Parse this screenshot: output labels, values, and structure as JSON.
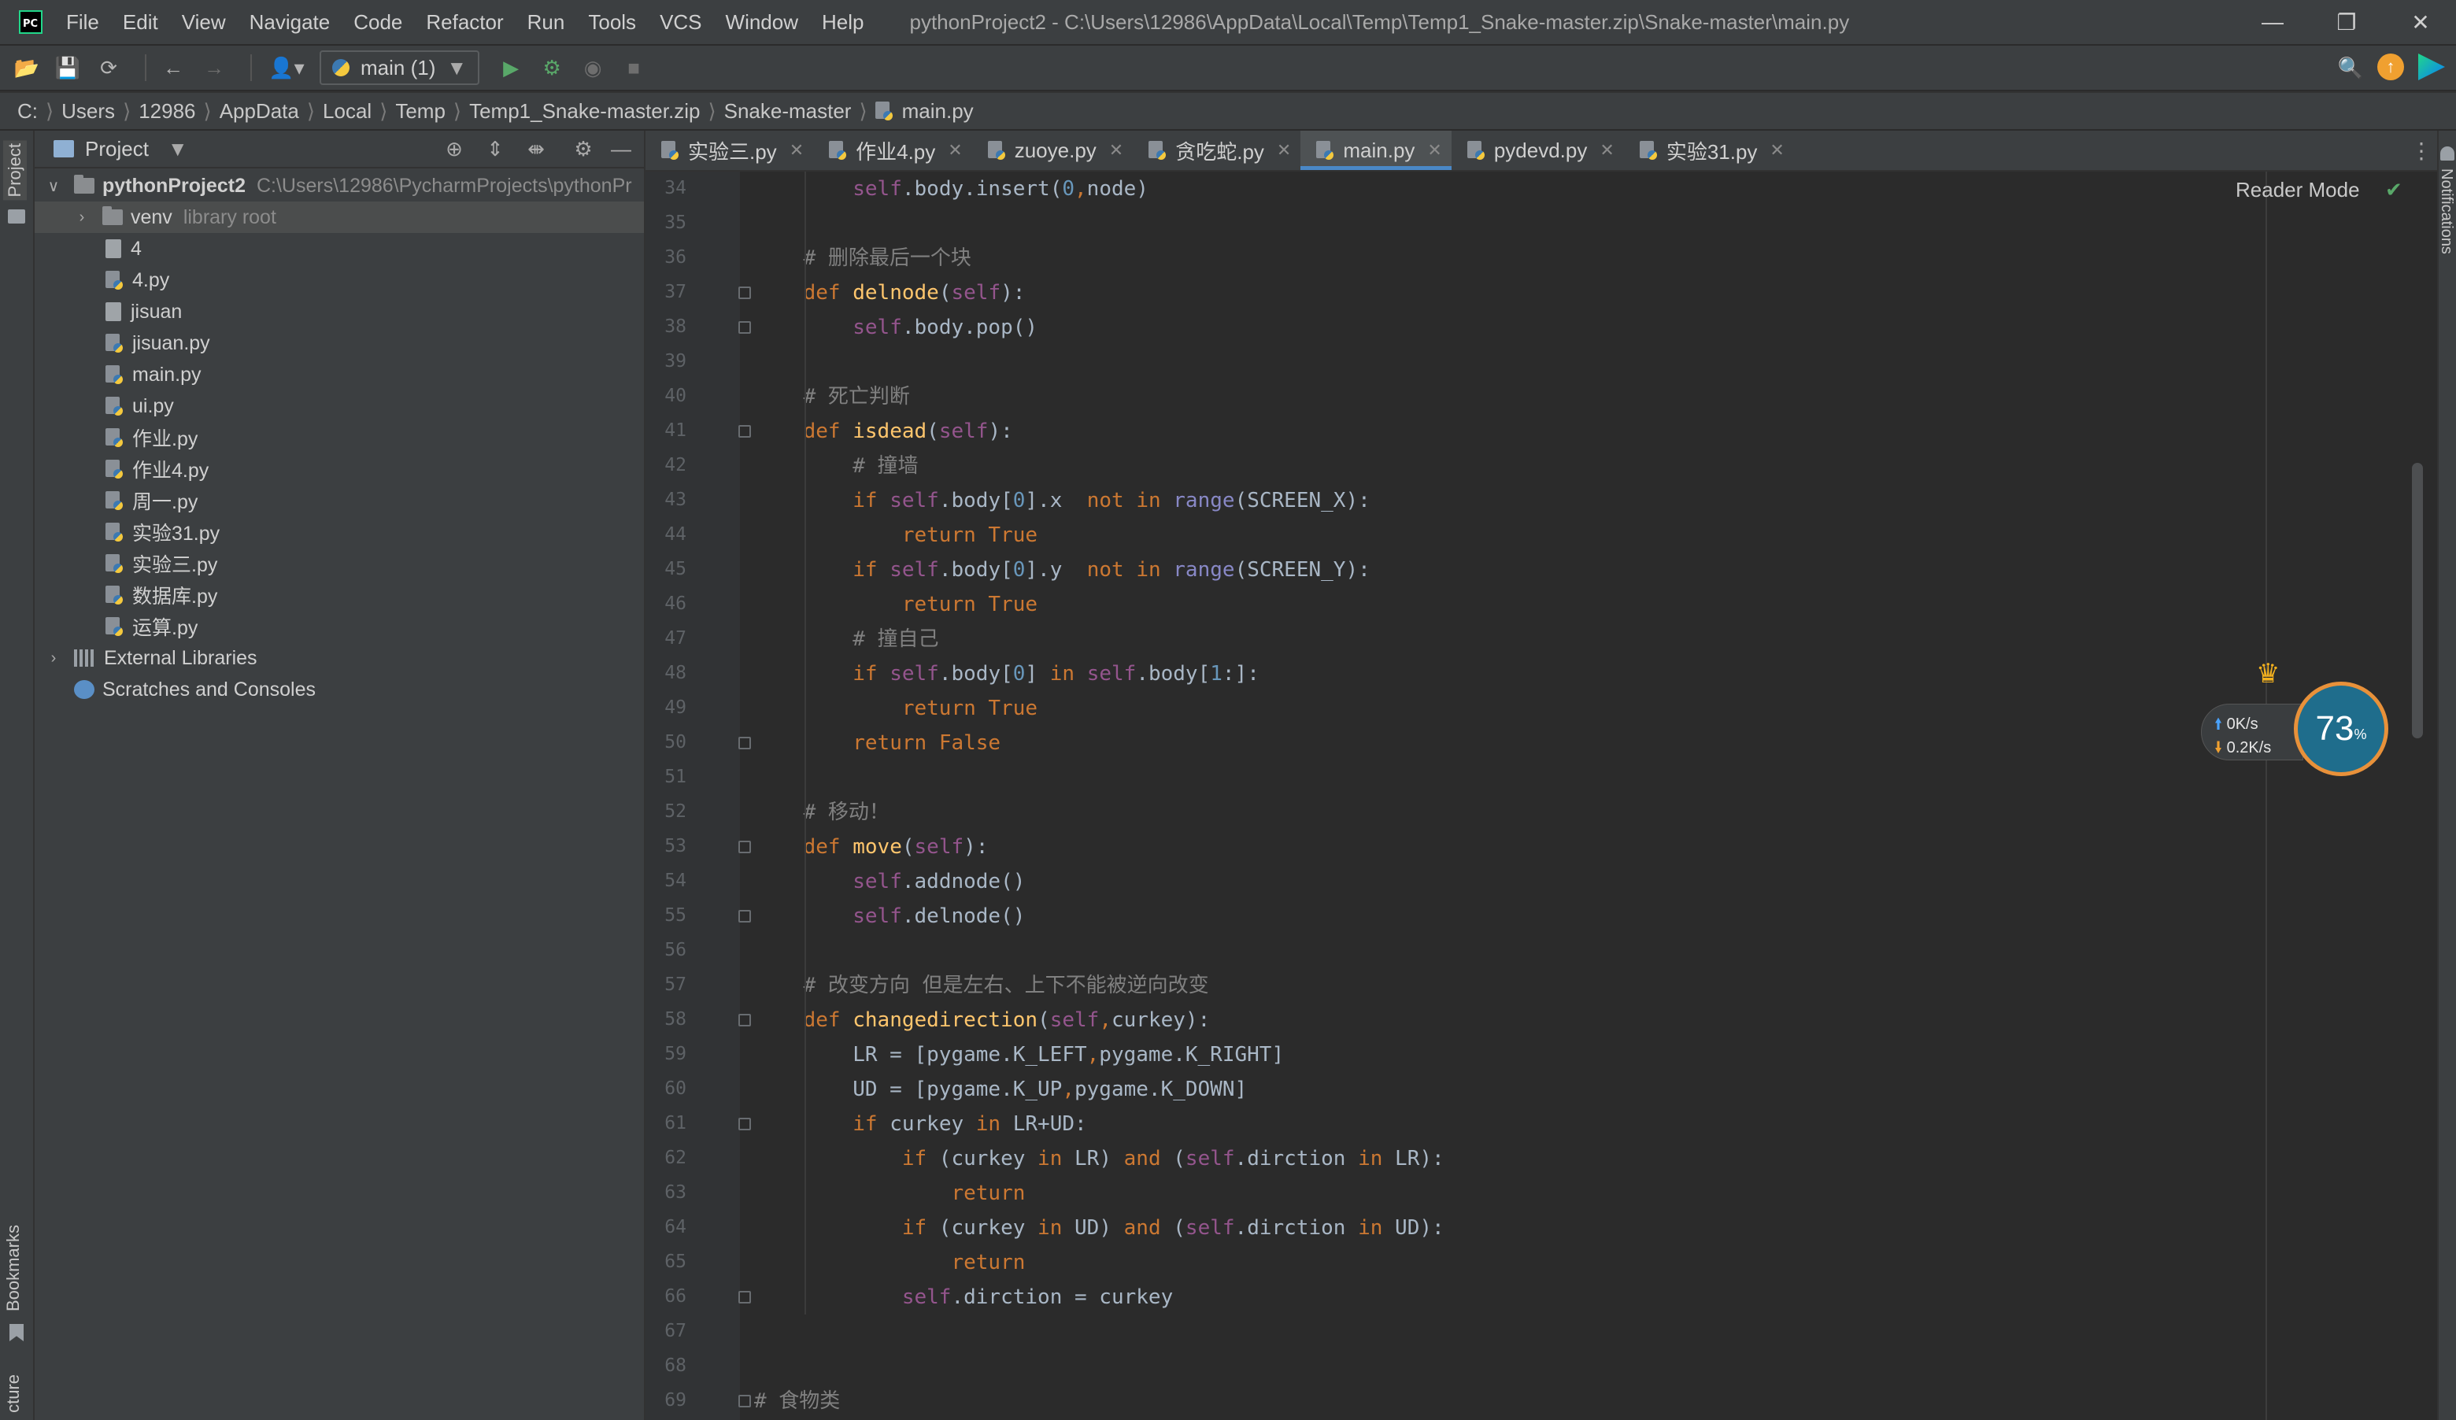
{
  "menu": {
    "items": [
      "File",
      "Edit",
      "View",
      "Navigate",
      "Code",
      "Refactor",
      "Run",
      "Tools",
      "VCS",
      "Window",
      "Help"
    ],
    "window_title": "pythonProject2 - C:\\Users\\12986\\AppData\\Local\\Temp\\Temp1_Snake-master.zip\\Snake-master\\main.py"
  },
  "toolbar": {
    "run_config": "main (1)"
  },
  "breadcrumb": [
    "C:",
    "Users",
    "12986",
    "AppData",
    "Local",
    "Temp",
    "Temp1_Snake-master.zip",
    "Snake-master",
    "main.py"
  ],
  "left_stripe": {
    "project": "Project",
    "bookmarks": "Bookmarks",
    "structure": "cture"
  },
  "right_stripe": {
    "notifications": "Notifications"
  },
  "project_panel": {
    "title": "Project",
    "root": {
      "name": "pythonProject2",
      "path": "C:\\Users\\12986\\PycharmProjects\\pythonPr"
    },
    "venv": {
      "name": "venv",
      "note": "library root"
    },
    "files": [
      {
        "name": "4",
        "type": "text"
      },
      {
        "name": "4.py",
        "type": "py"
      },
      {
        "name": "jisuan",
        "type": "text"
      },
      {
        "name": "jisuan.py",
        "type": "py"
      },
      {
        "name": "main.py",
        "type": "py"
      },
      {
        "name": "ui.py",
        "type": "py"
      },
      {
        "name": "作业.py",
        "type": "py"
      },
      {
        "name": "作业4.py",
        "type": "py"
      },
      {
        "name": "周一.py",
        "type": "py"
      },
      {
        "name": "实验31.py",
        "type": "py"
      },
      {
        "name": "实验三.py",
        "type": "py"
      },
      {
        "name": "数据库.py",
        "type": "py"
      },
      {
        "name": "运算.py",
        "type": "py"
      }
    ],
    "external_libraries": "External Libraries",
    "scratches": "Scratches and Consoles"
  },
  "tabs": [
    {
      "label": "实验三.py",
      "active": false
    },
    {
      "label": "作业4.py",
      "active": false
    },
    {
      "label": "zuoye.py",
      "active": false
    },
    {
      "label": "贪吃蛇.py",
      "active": false
    },
    {
      "label": "main.py",
      "active": true
    },
    {
      "label": "pydevd.py",
      "active": false
    },
    {
      "label": "实验31.py",
      "active": false
    }
  ],
  "editor": {
    "reader_mode": "Reader Mode",
    "line_numbers": [
      "34",
      "35",
      "36",
      "37",
      "38",
      "39",
      "40",
      "41",
      "42",
      "43",
      "44",
      "45",
      "46",
      "47",
      "48",
      "49",
      "50",
      "51",
      "52",
      "53",
      "54",
      "55",
      "56",
      "57",
      "58",
      "59",
      "60",
      "61",
      "62",
      "63",
      "64",
      "65",
      "66",
      "67",
      "68",
      "69"
    ],
    "code_lines": [
      "        self.body.insert(0,node)",
      "",
      "    # 删除最后一个块",
      "    def delnode(self):",
      "        self.body.pop()",
      "",
      "    # 死亡判断",
      "    def isdead(self):",
      "        # 撞墙",
      "        if self.body[0].x  not in range(SCREEN_X):",
      "            return True",
      "        if self.body[0].y  not in range(SCREEN_Y):",
      "            return True",
      "        # 撞自己",
      "        if self.body[0] in self.body[1:]:",
      "            return True",
      "        return False",
      "",
      "    # 移动！",
      "    def move(self):",
      "        self.addnode()",
      "        self.delnode()",
      "",
      "    # 改变方向 但是左右、上下不能被逆向改变",
      "    def changedirection(self,curkey):",
      "        LR = [pygame.K_LEFT,pygame.K_RIGHT]",
      "        UD = [pygame.K_UP,pygame.K_DOWN]",
      "        if curkey in LR+UD:",
      "            if (curkey in LR) and (self.dirction in LR):",
      "                return",
      "            if (curkey in UD) and (self.dirction in UD):",
      "                return",
      "            self.dirction = curkey",
      "",
      "",
      "# 食物类"
    ]
  },
  "net_widget": {
    "upload": "0K/s",
    "download": "0.2K/s",
    "percent": "73",
    "percent_unit": "%"
  },
  "colors": {
    "accent": "#4a88c7",
    "keyword": "#cc7832",
    "self": "#94558d",
    "function": "#ffc66d",
    "number": "#6897bb",
    "comment": "#808080"
  }
}
